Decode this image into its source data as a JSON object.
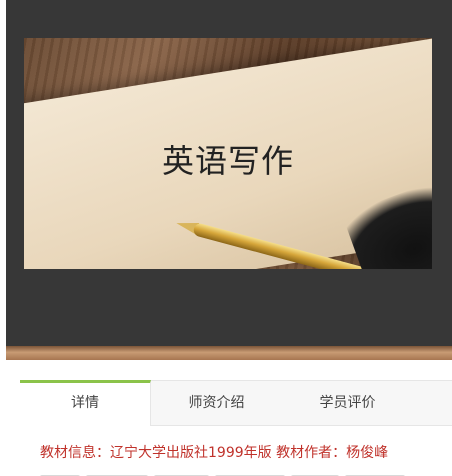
{
  "cover": {
    "title": "英语写作"
  },
  "tabs": [
    {
      "label": "详情",
      "active": true
    },
    {
      "label": "师资介绍",
      "active": false
    },
    {
      "label": "学员评价",
      "active": false
    }
  ],
  "details": {
    "info_line": "教材信息：辽宁大学出版社1999年版 教材作者：杨俊峰"
  },
  "colors": {
    "tab_active_accent": "#8bc34a",
    "info_text": "#c0322b",
    "video_background": "#373737"
  }
}
